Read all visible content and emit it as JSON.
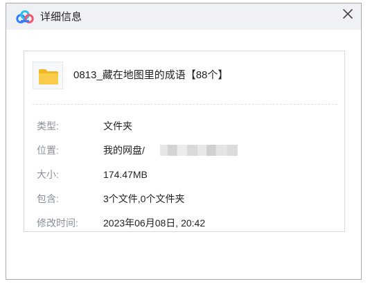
{
  "window": {
    "title": "详细信息",
    "close_glyph": "×"
  },
  "icons": {
    "app_logo": "cloud-logo-icon",
    "close": "close-icon",
    "folder": "folder-icon"
  },
  "colors": {
    "titlebar_bg": "#eff1f4",
    "label_text": "#8a8f99",
    "value_text": "#222222",
    "folder_yellow": "#f7c744",
    "logo_blue": "#2f7bff",
    "logo_cyan": "#29c0f0",
    "logo_pink": "#f2546c"
  },
  "file": {
    "name": "0813_藏在地图里的成语【88个】"
  },
  "details": {
    "type_label": "类型:",
    "type_value": "文件夹",
    "location_label": "位置:",
    "location_value": "我的网盘/",
    "size_label": "大小:",
    "size_value": "174.47MB",
    "contains_label": "包含:",
    "contains_value": "3个文件,0个文件夹",
    "modified_label": "修改时间:",
    "modified_value": "2023年06月08日, 20:42"
  }
}
